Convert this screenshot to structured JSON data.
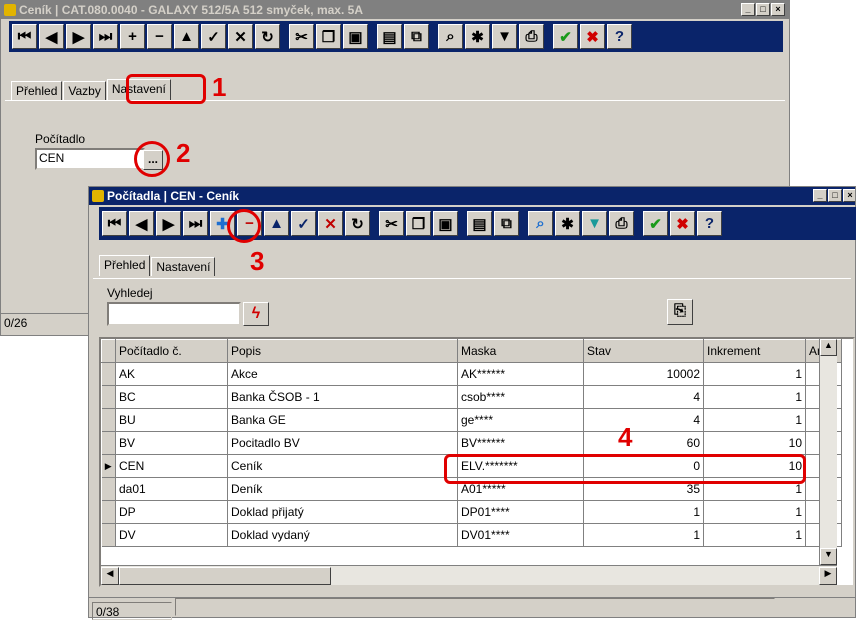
{
  "back_window": {
    "title": "Ceník | CAT.080.0040 - GALAXY 512/5A 512 smyček, max. 5A",
    "window_buttons": [
      "_",
      "□",
      "×"
    ],
    "tabs": [
      "Přehled",
      "Vazby",
      "Nastavení"
    ],
    "counter_label": "Počítadlo",
    "counter_value": "CEN",
    "browse_button": "...",
    "status": "0/26"
  },
  "front_window": {
    "title": "Počítadla | CEN - Ceník",
    "window_buttons": [
      "_",
      "□",
      "×"
    ],
    "tabs": [
      "Přehled",
      "Nastavení"
    ],
    "search_label": "Vyhledej",
    "search_value": "",
    "status": "0/38",
    "columns": [
      "Počítadlo č.",
      "Popis",
      "Maska",
      "Stav",
      "Inkrement",
      "Ano"
    ],
    "rows": [
      {
        "code": "AK",
        "desc": "Akce",
        "mask": "AK******",
        "state": "10002",
        "inc": "1"
      },
      {
        "code": "BC",
        "desc": "Banka ČSOB - 1",
        "mask": "csob****",
        "state": "4",
        "inc": "1"
      },
      {
        "code": "BU",
        "desc": "Banka GE",
        "mask": "ge****",
        "state": "4",
        "inc": "1"
      },
      {
        "code": "BV",
        "desc": "Pocitadlo BV",
        "mask": "BV******",
        "state": "60",
        "inc": "10"
      },
      {
        "code": "CEN",
        "desc": "Ceník",
        "mask": "ELV.*******",
        "state": "0",
        "inc": "10"
      },
      {
        "code": "da01",
        "desc": "Deník",
        "mask": "A01*****",
        "state": "35",
        "inc": "1"
      },
      {
        "code": "DP",
        "desc": "Doklad přijatý",
        "mask": "DP01****",
        "state": "1",
        "inc": "1"
      },
      {
        "code": "DV",
        "desc": "Doklad vydaný",
        "mask": "DV01****",
        "state": "1",
        "inc": "1"
      }
    ]
  },
  "callouts": [
    "1",
    "2",
    "3",
    "4"
  ],
  "colors": {
    "active_title": "#0a246a",
    "inactive_title": "#808080",
    "callout_red": "#e00000",
    "face": "#d4d0c8"
  }
}
